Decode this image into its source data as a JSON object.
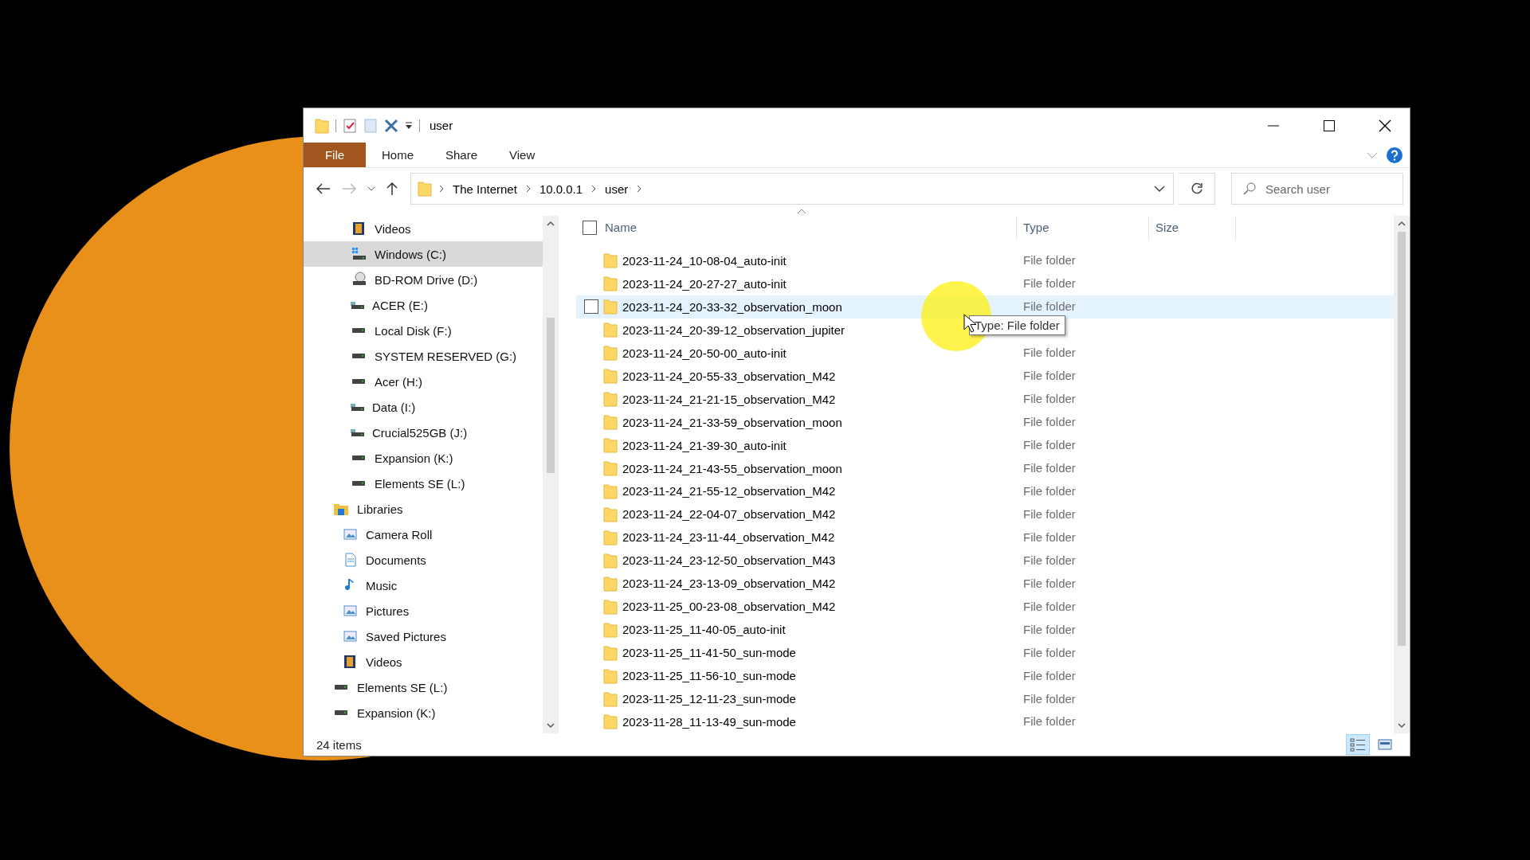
{
  "window": {
    "title": "user"
  },
  "ribbon": {
    "file_menu": "File",
    "tabs": [
      "Home",
      "Share",
      "View"
    ]
  },
  "address_bar": {
    "segments": [
      "The Internet",
      "10.0.0.1",
      "user"
    ]
  },
  "search": {
    "placeholder": "Search user"
  },
  "sidebar": {
    "tree": [
      {
        "children": [
          {
            "label": "Videos",
            "kind": "video",
            "selected": false
          },
          {
            "label": "Windows (C:)",
            "kind": "system-drive",
            "selected": true
          },
          {
            "label": "BD-ROM Drive (D:)",
            "kind": "disc-drive",
            "selected": false
          },
          {
            "label": "ACER (E:)",
            "kind": "shared-drive",
            "selected": false
          },
          {
            "label": "Local Disk (F:)",
            "kind": "drive",
            "selected": false
          },
          {
            "label": "SYSTEM RESERVED (G:)",
            "kind": "drive",
            "selected": false
          },
          {
            "label": "Acer (H:)",
            "kind": "drive",
            "selected": false
          },
          {
            "label": "Data (I:)",
            "kind": "shared-drive",
            "selected": false
          },
          {
            "label": "Crucial525GB (J:)",
            "kind": "shared-drive",
            "selected": false
          },
          {
            "label": "Expansion (K:)",
            "kind": "drive",
            "selected": false
          },
          {
            "label": "Elements SE (L:)",
            "kind": "drive",
            "selected": false
          }
        ]
      },
      {
        "label": "Libraries",
        "kind": "library",
        "selected": false,
        "children": [
          {
            "label": "Camera Roll",
            "kind": "pictures",
            "selected": false
          },
          {
            "label": "Documents",
            "kind": "documents",
            "selected": false
          },
          {
            "label": "Music",
            "kind": "music",
            "selected": false
          },
          {
            "label": "Pictures",
            "kind": "pictures",
            "selected": false
          },
          {
            "label": "Saved Pictures",
            "kind": "pictures",
            "selected": false
          },
          {
            "label": "Videos",
            "kind": "video",
            "selected": false
          }
        ]
      },
      {
        "label": "Elements SE (L:)",
        "kind": "drive",
        "selected": false
      },
      {
        "label": "Expansion (K:)",
        "kind": "drive",
        "selected": false
      }
    ]
  },
  "file_list": {
    "columns": [
      "Name",
      "Type",
      "Size"
    ],
    "select_all": {
      "checked": false
    },
    "rows": [
      {
        "name": "2023-11-24_10-08-04_auto-init",
        "type": "File folder",
        "hovered": false
      },
      {
        "name": "2023-11-24_20-27-27_auto-init",
        "type": "File folder",
        "hovered": false
      },
      {
        "name": "2023-11-24_20-33-32_observation_moon",
        "type": "File folder",
        "hovered": true
      },
      {
        "name": "2023-11-24_20-39-12_observation_jupiter",
        "hovered": false
      },
      {
        "name": "2023-11-24_20-50-00_auto-init",
        "type": "File folder",
        "hovered": false
      },
      {
        "name": "2023-11-24_20-55-33_observation_M42",
        "type": "File folder",
        "hovered": false
      },
      {
        "name": "2023-11-24_21-21-15_observation_M42",
        "type": "File folder",
        "hovered": false
      },
      {
        "name": "2023-11-24_21-33-59_observation_moon",
        "type": "File folder",
        "hovered": false
      },
      {
        "name": "2023-11-24_21-39-30_auto-init",
        "type": "File folder",
        "hovered": false
      },
      {
        "name": "2023-11-24_21-43-55_observation_moon",
        "type": "File folder",
        "hovered": false
      },
      {
        "name": "2023-11-24_21-55-12_observation_M42",
        "type": "File folder",
        "hovered": false
      },
      {
        "name": "2023-11-24_22-04-07_observation_M42",
        "type": "File folder",
        "hovered": false
      },
      {
        "name": "2023-11-24_23-11-44_observation_M42",
        "type": "File folder",
        "hovered": false
      },
      {
        "name": "2023-11-24_23-12-50_observation_M43",
        "type": "File folder",
        "hovered": false
      },
      {
        "name": "2023-11-24_23-13-09_observation_M42",
        "type": "File folder",
        "hovered": false
      },
      {
        "name": "2023-11-25_00-23-08_observation_M42",
        "type": "File folder",
        "hovered": false
      },
      {
        "name": "2023-11-25_11-40-05_auto-init",
        "type": "File folder",
        "hovered": false
      },
      {
        "name": "2023-11-25_11-41-50_sun-mode",
        "type": "File folder",
        "hovered": false
      },
      {
        "name": "2023-11-25_11-56-10_sun-mode",
        "type": "File folder",
        "hovered": false
      },
      {
        "name": "2023-11-25_12-11-23_sun-mode",
        "type": "File folder",
        "hovered": false
      },
      {
        "name": "2023-11-28_11-13-49_sun-mode",
        "type": "File folder",
        "hovered": false
      }
    ],
    "tooltip": "Type: File folder"
  },
  "status_bar": {
    "count": "24 items",
    "view_buttons": [
      {
        "kind": "details",
        "selected": true
      },
      {
        "kind": "large-icons",
        "selected": false
      }
    ]
  }
}
